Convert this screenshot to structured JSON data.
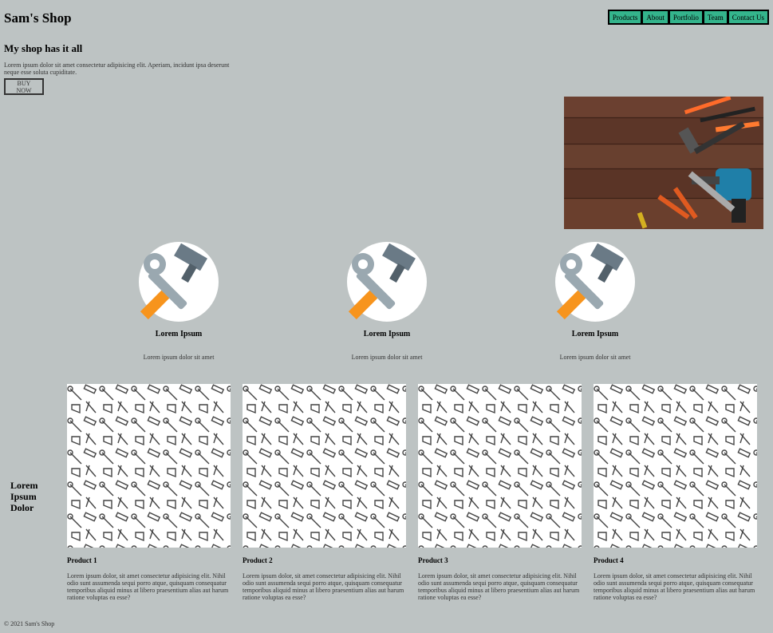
{
  "header": {
    "brand": "Sam's Shop"
  },
  "nav": {
    "items": [
      "Products",
      "About",
      "Portfolio",
      "Team",
      "Contact Us"
    ],
    "color": "#34b48c"
  },
  "hero": {
    "title": "My shop has it all",
    "text": "Lorem ipsum dolor sit amet consectetur adipisicing elit. Aperiam, incidunt ipsa deserunt neque esse soluta cupiditate.",
    "button_label": "BUY NOW",
    "image": "tools-on-wood-image"
  },
  "features": [
    {
      "title": "Lorem Ipsum",
      "text": "Lorem ipsum dolor sit amet",
      "icon": "hammer-wrench-icon"
    },
    {
      "title": "Lorem Ipsum",
      "text": "Lorem ipsum dolor sit amet",
      "icon": "hammer-wrench-icon"
    },
    {
      "title": "Lorem Ipsum",
      "text": "Lorem ipsum dolor sit amet",
      "icon": "hammer-wrench-icon"
    }
  ],
  "products_section": {
    "heading": "Lorem Ipsum Dolor"
  },
  "products": [
    {
      "name": "Product 1",
      "desc": "Lorem ipsum dolor, sit amet consectetur adipisicing elit. Nihil odio sunt assumenda sequi porro atque, quisquam consequatur temporibus aliquid minus at libero praesentium alias aut harum ratione voluptas ea esse?"
    },
    {
      "name": "Product 2",
      "desc": "Lorem ipsum dolor, sit amet consectetur adipisicing elit. Nihil odio sunt assumenda sequi porro atque, quisquam consequatur temporibus aliquid minus at libero praesentium alias aut harum ratione voluptas ea esse?"
    },
    {
      "name": "Product 3",
      "desc": "Lorem ipsum dolor, sit amet consectetur adipisicing elit. Nihil odio sunt assumenda sequi porro atque, quisquam consequatur temporibus aliquid minus at libero praesentium alias aut harum ratione voluptas ea esse?"
    },
    {
      "name": "Product 4",
      "desc": "Lorem ipsum dolor, sit amet consectetur adipisicing elit. Nihil odio sunt assumenda sequi porro atque, quisquam consequatur temporibus aliquid minus at libero praesentium alias aut harum ratione voluptas ea esse?"
    }
  ],
  "footer": {
    "text": "© 2021 Sam's Shop"
  }
}
